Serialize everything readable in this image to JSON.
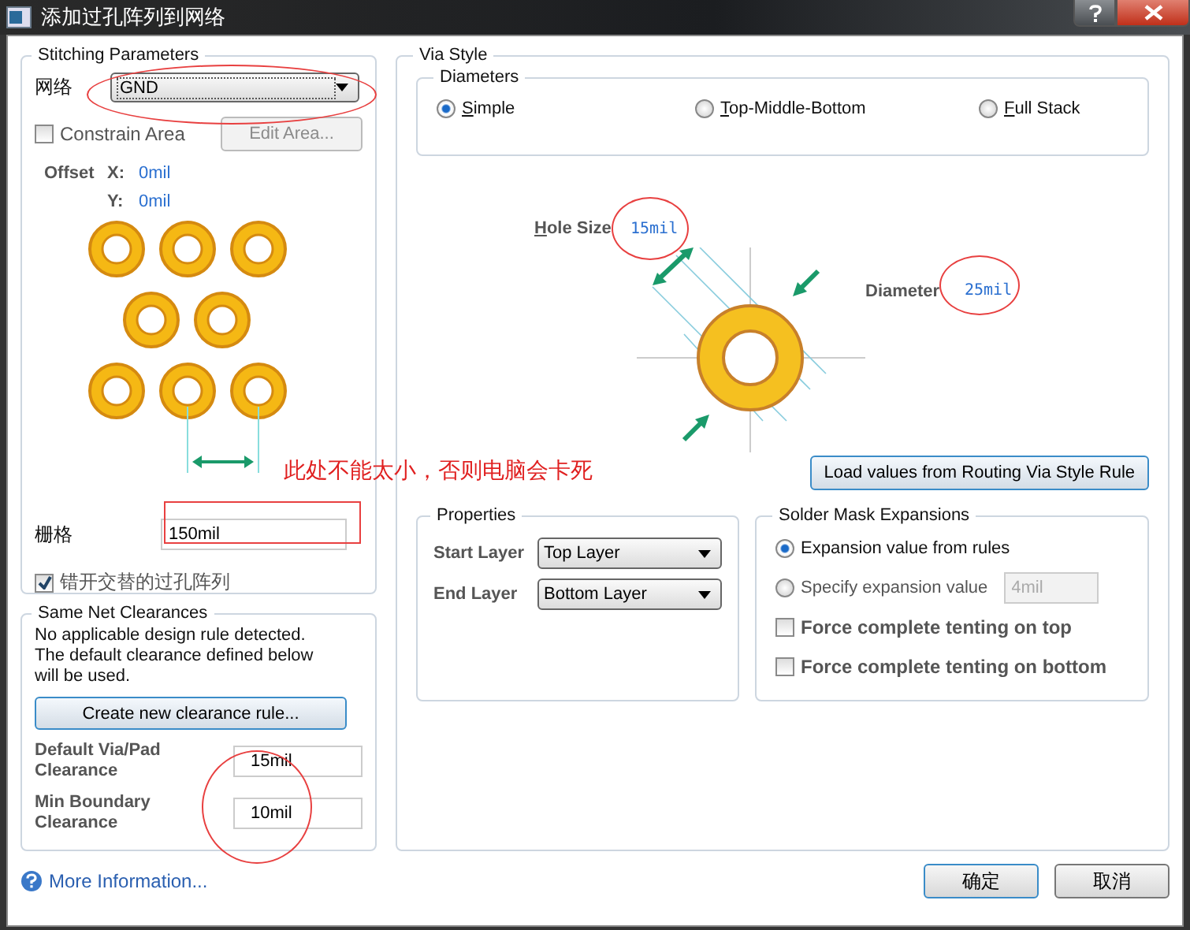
{
  "window": {
    "title": "添加过孔阵列到网络"
  },
  "stitching": {
    "title": "Stitching Parameters",
    "net_label": "网络",
    "net_value": "GND",
    "constrain_area": {
      "label": "Constrain Area",
      "checked": false
    },
    "edit_area": {
      "label": "Edit Area...",
      "disabled": true
    },
    "offset_label": "Offset",
    "offset_x_label": "X:",
    "offset_x": "0mil",
    "offset_y_label": "Y:",
    "offset_y": "0mil",
    "grid_label": "栅格",
    "grid_value": "150mil",
    "stagger": {
      "label": "错开交替的过孔阵列",
      "checked": true
    }
  },
  "clearances": {
    "title": "Same Net Clearances",
    "message": "No applicable design rule detected. The default clearance defined below will be used.",
    "create_button": "Create new clearance rule...",
    "fields": [
      {
        "label": "Default Via/Pad Clearance",
        "value": "15mil"
      },
      {
        "label": "Min Boundary Clearance",
        "value": "10mil"
      }
    ]
  },
  "via_style": {
    "title": "Via Style",
    "diameters": {
      "title": "Diameters",
      "options": [
        {
          "label": "Simple",
          "selected": true
        },
        {
          "label": "Top-Middle-Bottom",
          "selected": false
        },
        {
          "label": "Full Stack",
          "selected": false
        }
      ]
    },
    "hole_size_label": "Hole Size",
    "hole_size": "15mil",
    "diameter_label": "Diameter",
    "diameter": "25mil",
    "load_button": "Load values from Routing Via Style Rule",
    "properties": {
      "title": "Properties",
      "start_label": "Start Layer",
      "start_value": "Top Layer",
      "end_label": "End Layer",
      "end_value": "Bottom Layer"
    },
    "solder_mask": {
      "title": "Solder Mask Expansions",
      "options": [
        {
          "label": "Expansion value from rules",
          "selected": true
        },
        {
          "label": "Specify expansion value",
          "selected": false
        }
      ],
      "expansion_value": "4mil",
      "tenting": [
        {
          "label": "Force complete tenting on top",
          "checked": false
        },
        {
          "label": "Force complete tenting on bottom",
          "checked": false
        }
      ]
    }
  },
  "footer": {
    "more_info": "More Information...",
    "ok": "确定",
    "cancel": "取消"
  },
  "annotation": {
    "note": "此处不能太小，否则电脑会卡死"
  }
}
